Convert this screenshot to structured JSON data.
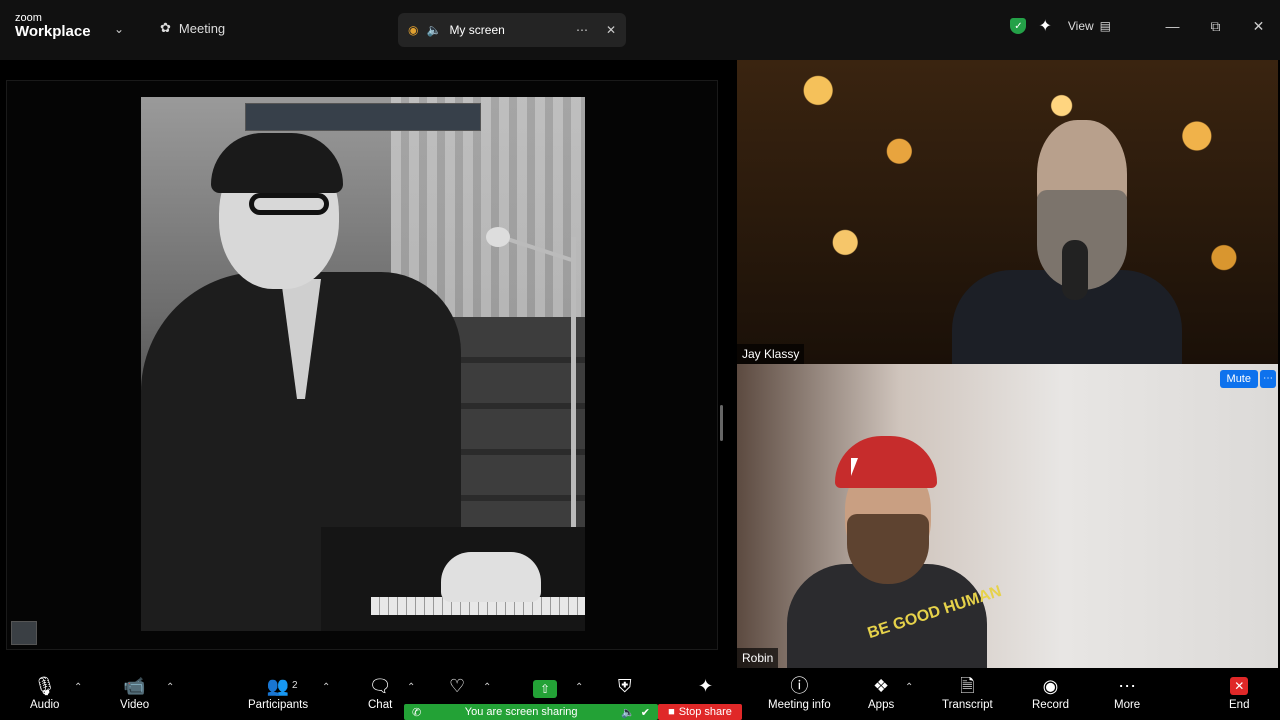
{
  "app": {
    "brand_small": "zoom",
    "brand_big": "Workplace"
  },
  "titlebar": {
    "meeting_label": "Meeting",
    "share_tab_label": "My screen",
    "view_label": "View"
  },
  "participants": {
    "top_name": "Jay Klassy",
    "bottom_name": "Robin",
    "mute_label": "Mute",
    "shirt_text": "BE GOOD HUMAN"
  },
  "toolbar": {
    "audio": "Audio",
    "video": "Video",
    "participants": "Participants",
    "participants_count": "2",
    "chat": "Chat",
    "sharing_status": "You are screen sharing",
    "stop_share": "Stop share",
    "meeting_info": "Meeting info",
    "apps": "Apps",
    "transcript": "Transcript",
    "record": "Record",
    "more": "More",
    "end": "End"
  },
  "colors": {
    "accent_blue": "#0e72ed",
    "share_green": "#23a236",
    "stop_red": "#e02828"
  }
}
